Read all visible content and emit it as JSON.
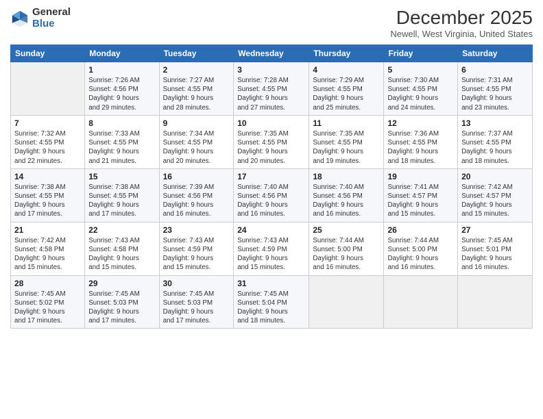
{
  "logo": {
    "general": "General",
    "blue": "Blue"
  },
  "header": {
    "month": "December 2025",
    "location": "Newell, West Virginia, United States"
  },
  "weekdays": [
    "Sunday",
    "Monday",
    "Tuesday",
    "Wednesday",
    "Thursday",
    "Friday",
    "Saturday"
  ],
  "weeks": [
    [
      {
        "day": "",
        "info": ""
      },
      {
        "day": "1",
        "info": "Sunrise: 7:26 AM\nSunset: 4:56 PM\nDaylight: 9 hours\nand 29 minutes."
      },
      {
        "day": "2",
        "info": "Sunrise: 7:27 AM\nSunset: 4:55 PM\nDaylight: 9 hours\nand 28 minutes."
      },
      {
        "day": "3",
        "info": "Sunrise: 7:28 AM\nSunset: 4:55 PM\nDaylight: 9 hours\nand 27 minutes."
      },
      {
        "day": "4",
        "info": "Sunrise: 7:29 AM\nSunset: 4:55 PM\nDaylight: 9 hours\nand 25 minutes."
      },
      {
        "day": "5",
        "info": "Sunrise: 7:30 AM\nSunset: 4:55 PM\nDaylight: 9 hours\nand 24 minutes."
      },
      {
        "day": "6",
        "info": "Sunrise: 7:31 AM\nSunset: 4:55 PM\nDaylight: 9 hours\nand 23 minutes."
      }
    ],
    [
      {
        "day": "7",
        "info": "Sunrise: 7:32 AM\nSunset: 4:55 PM\nDaylight: 9 hours\nand 22 minutes."
      },
      {
        "day": "8",
        "info": "Sunrise: 7:33 AM\nSunset: 4:55 PM\nDaylight: 9 hours\nand 21 minutes."
      },
      {
        "day": "9",
        "info": "Sunrise: 7:34 AM\nSunset: 4:55 PM\nDaylight: 9 hours\nand 20 minutes."
      },
      {
        "day": "10",
        "info": "Sunrise: 7:35 AM\nSunset: 4:55 PM\nDaylight: 9 hours\nand 20 minutes."
      },
      {
        "day": "11",
        "info": "Sunrise: 7:35 AM\nSunset: 4:55 PM\nDaylight: 9 hours\nand 19 minutes."
      },
      {
        "day": "12",
        "info": "Sunrise: 7:36 AM\nSunset: 4:55 PM\nDaylight: 9 hours\nand 18 minutes."
      },
      {
        "day": "13",
        "info": "Sunrise: 7:37 AM\nSunset: 4:55 PM\nDaylight: 9 hours\nand 18 minutes."
      }
    ],
    [
      {
        "day": "14",
        "info": "Sunrise: 7:38 AM\nSunset: 4:55 PM\nDaylight: 9 hours\nand 17 minutes."
      },
      {
        "day": "15",
        "info": "Sunrise: 7:38 AM\nSunset: 4:55 PM\nDaylight: 9 hours\nand 17 minutes."
      },
      {
        "day": "16",
        "info": "Sunrise: 7:39 AM\nSunset: 4:56 PM\nDaylight: 9 hours\nand 16 minutes."
      },
      {
        "day": "17",
        "info": "Sunrise: 7:40 AM\nSunset: 4:56 PM\nDaylight: 9 hours\nand 16 minutes."
      },
      {
        "day": "18",
        "info": "Sunrise: 7:40 AM\nSunset: 4:56 PM\nDaylight: 9 hours\nand 16 minutes."
      },
      {
        "day": "19",
        "info": "Sunrise: 7:41 AM\nSunset: 4:57 PM\nDaylight: 9 hours\nand 15 minutes."
      },
      {
        "day": "20",
        "info": "Sunrise: 7:42 AM\nSunset: 4:57 PM\nDaylight: 9 hours\nand 15 minutes."
      }
    ],
    [
      {
        "day": "21",
        "info": "Sunrise: 7:42 AM\nSunset: 4:58 PM\nDaylight: 9 hours\nand 15 minutes."
      },
      {
        "day": "22",
        "info": "Sunrise: 7:43 AM\nSunset: 4:58 PM\nDaylight: 9 hours\nand 15 minutes."
      },
      {
        "day": "23",
        "info": "Sunrise: 7:43 AM\nSunset: 4:59 PM\nDaylight: 9 hours\nand 15 minutes."
      },
      {
        "day": "24",
        "info": "Sunrise: 7:43 AM\nSunset: 4:59 PM\nDaylight: 9 hours\nand 15 minutes."
      },
      {
        "day": "25",
        "info": "Sunrise: 7:44 AM\nSunset: 5:00 PM\nDaylight: 9 hours\nand 16 minutes."
      },
      {
        "day": "26",
        "info": "Sunrise: 7:44 AM\nSunset: 5:00 PM\nDaylight: 9 hours\nand 16 minutes."
      },
      {
        "day": "27",
        "info": "Sunrise: 7:45 AM\nSunset: 5:01 PM\nDaylight: 9 hours\nand 16 minutes."
      }
    ],
    [
      {
        "day": "28",
        "info": "Sunrise: 7:45 AM\nSunset: 5:02 PM\nDaylight: 9 hours\nand 17 minutes."
      },
      {
        "day": "29",
        "info": "Sunrise: 7:45 AM\nSunset: 5:03 PM\nDaylight: 9 hours\nand 17 minutes."
      },
      {
        "day": "30",
        "info": "Sunrise: 7:45 AM\nSunset: 5:03 PM\nDaylight: 9 hours\nand 17 minutes."
      },
      {
        "day": "31",
        "info": "Sunrise: 7:45 AM\nSunset: 5:04 PM\nDaylight: 9 hours\nand 18 minutes."
      },
      {
        "day": "",
        "info": ""
      },
      {
        "day": "",
        "info": ""
      },
      {
        "day": "",
        "info": ""
      }
    ]
  ]
}
